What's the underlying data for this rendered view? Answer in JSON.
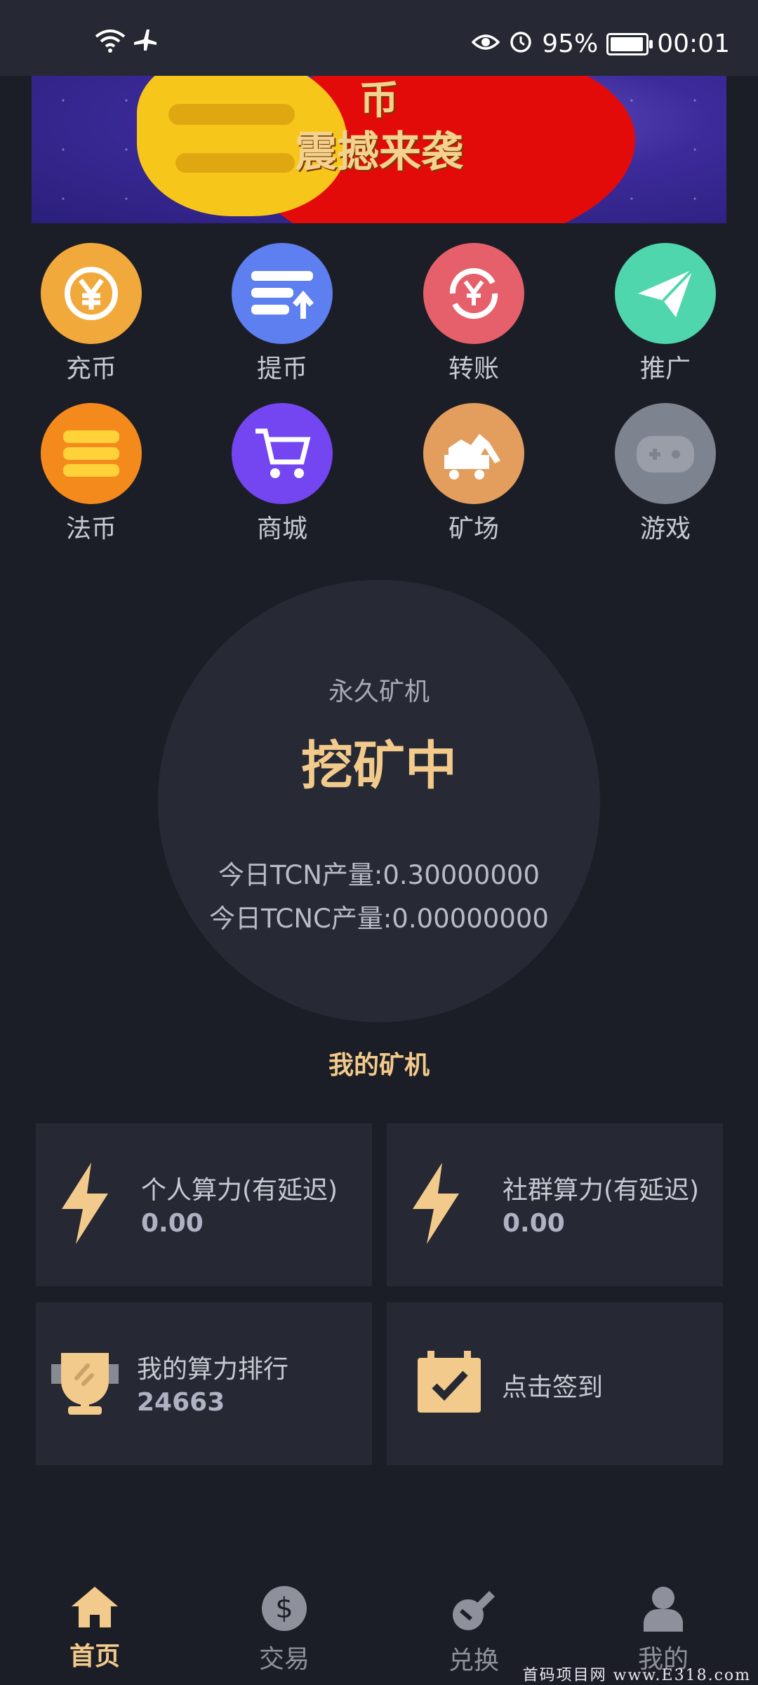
{
  "status_bar": {
    "battery": "95%",
    "time": "00:01"
  },
  "banner": {
    "line1": "币",
    "line2": "震撼来袭"
  },
  "grid": [
    {
      "label": "充币",
      "color": "#f0a93a"
    },
    {
      "label": "提币",
      "color": "#5d7ff0"
    },
    {
      "label": "转账",
      "color": "#e6606b"
    },
    {
      "label": "推广",
      "color": "#4fd6ad"
    },
    {
      "label": "法币",
      "color": "#f58a1c"
    },
    {
      "label": "商城",
      "color": "#7446f2"
    },
    {
      "label": "矿场",
      "color": "#e39e5e"
    },
    {
      "label": "游戏",
      "color": "#7e8390"
    }
  ],
  "mining": {
    "subtitle": "永久矿机",
    "status": "挖矿中",
    "tcn_today": "今日TCN产量:0.30000000",
    "tcnc_today": "今日TCNC产量:0.00000000"
  },
  "section_title": "我的矿机",
  "cards": {
    "personal": {
      "title": "个人算力(有延迟)",
      "value": "0.00"
    },
    "community": {
      "title": "社群算力(有延迟)",
      "value": "0.00"
    },
    "rank": {
      "title": "我的算力排行",
      "value": "24663"
    },
    "signin": {
      "title": "点击签到"
    }
  },
  "nav": [
    {
      "label": "首页",
      "active": true
    },
    {
      "label": "交易"
    },
    {
      "label": "兑换"
    },
    {
      "label": "我的"
    }
  ],
  "watermark": "首码项目网 www.E318.com",
  "colors": {
    "accent": "#f2ca8b",
    "background": "#1c1e27",
    "card": "#262833"
  }
}
